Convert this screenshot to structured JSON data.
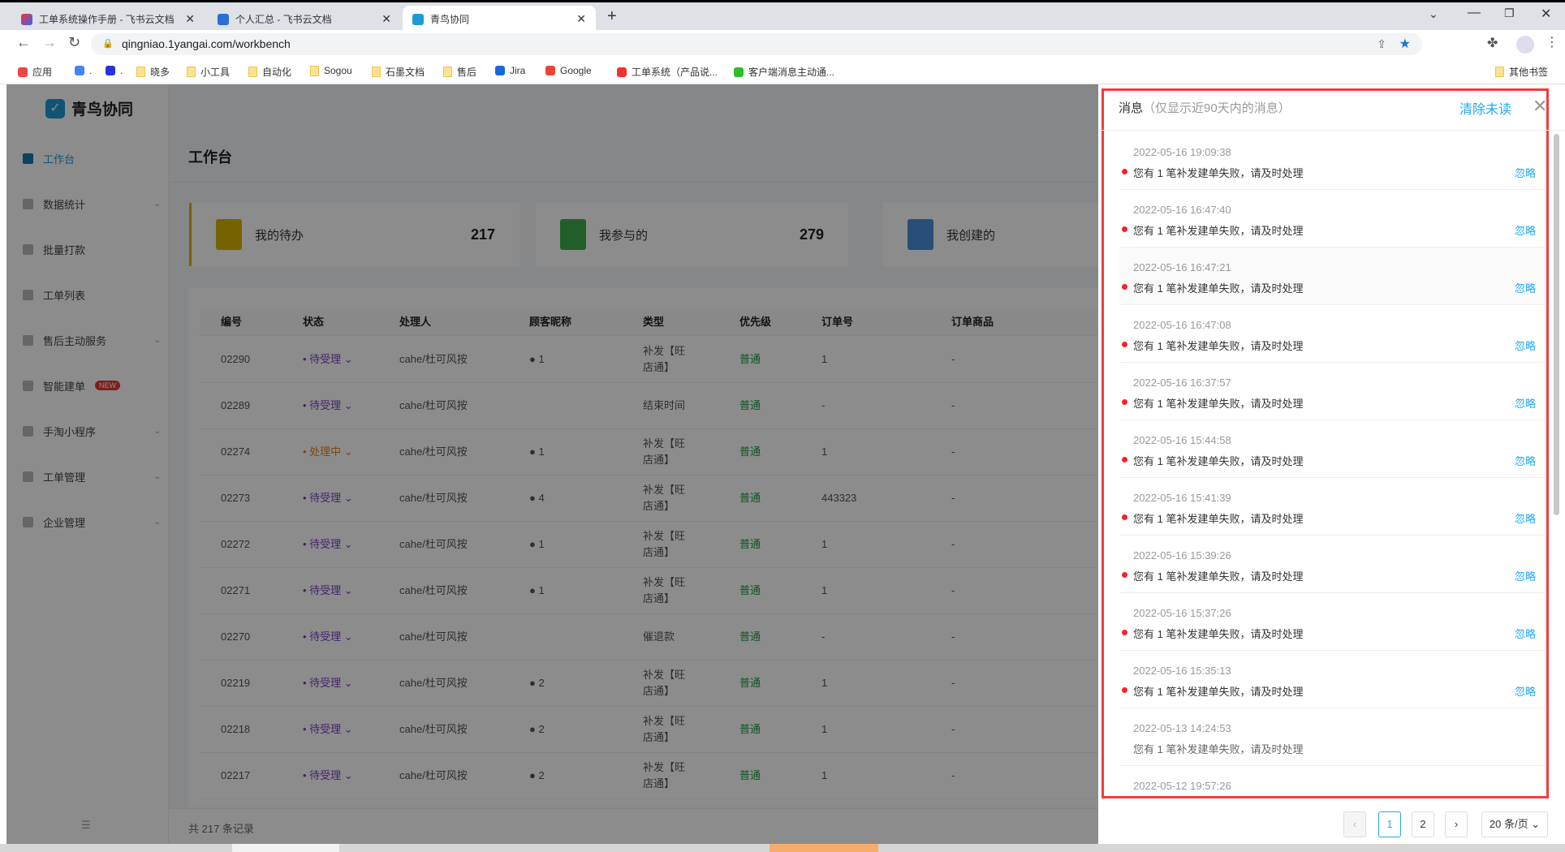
{
  "browser": {
    "tabs": [
      {
        "title": "工单系统操作手册 - 飞书云文档"
      },
      {
        "title": "个人汇总 - 飞书云文档"
      },
      {
        "title": "青鸟协同",
        "active": true
      }
    ],
    "url": "qingniao.1yangai.com/workbench",
    "bookmarks": [
      "应用",
      ".",
      ".",
      "晓多",
      "小工具",
      "自动化",
      "Sogou",
      "石墨文档",
      "售后",
      "Jira",
      "Google",
      "工单系统（产品说...",
      "客户端消息主动通..."
    ],
    "other_bookmarks": "其他书签"
  },
  "app": {
    "name": "青鸟协同",
    "brand_color": "#1e9ad6"
  },
  "sidebar": {
    "items": [
      {
        "label": "工作台",
        "active": true
      },
      {
        "label": "数据统计",
        "expand": true
      },
      {
        "label": "批量打款"
      },
      {
        "label": "工单列表"
      },
      {
        "label": "售后主动服务",
        "expand": true
      },
      {
        "label": "智能建单",
        "badge": "NEW"
      },
      {
        "label": "手淘小程序",
        "expand": true
      },
      {
        "label": "工单管理",
        "expand": true
      },
      {
        "label": "企业管理",
        "expand": true
      }
    ]
  },
  "main": {
    "title": "工作台",
    "cards": [
      {
        "label": "我的待办",
        "count": "217",
        "color": "#d8b400"
      },
      {
        "label": "我参与的",
        "count": "279",
        "color": "#3fae49"
      },
      {
        "label": "我创建的",
        "count": "",
        "color": "#4a90d9"
      }
    ],
    "table": {
      "columns": [
        "编号",
        "状态",
        "处理人",
        "顾客昵称",
        "类型",
        "优先级",
        "订单号",
        "订单商品"
      ],
      "rows": [
        [
          "02290",
          "待受理",
          "cahe/杜可风按",
          "1",
          "补发【旺店通】",
          "普通",
          "1",
          "-"
        ],
        [
          "02289",
          "待受理",
          "cahe/杜可风按",
          "",
          "结束时间",
          "普通",
          "-",
          "-"
        ],
        [
          "02274",
          "处理中",
          "cahe/杜可风按",
          "1",
          "补发【旺店通】",
          "普通",
          "1",
          "-"
        ],
        [
          "02273",
          "待受理",
          "cahe/杜可风按",
          "4",
          "补发【旺店通】",
          "普通",
          "443323",
          "-"
        ],
        [
          "02272",
          "待受理",
          "cahe/杜可风按",
          "1",
          "补发【旺店通】",
          "普通",
          "1",
          "-"
        ],
        [
          "02271",
          "待受理",
          "cahe/杜可风按",
          "1",
          "补发【旺店通】",
          "普通",
          "1",
          "-"
        ],
        [
          "02270",
          "待受理",
          "cahe/杜可风按",
          "",
          "催退款",
          "普通",
          "-",
          "-"
        ],
        [
          "02219",
          "待受理",
          "cahe/杜可风按",
          "2",
          "补发【旺店通】",
          "普通",
          "1",
          "-"
        ],
        [
          "02218",
          "待受理",
          "cahe/杜可风按",
          "2",
          "补发【旺店通】",
          "普通",
          "1",
          "-"
        ],
        [
          "02217",
          "待受理",
          "cahe/杜可风按",
          "2",
          "补发【旺店通】",
          "普通",
          "1",
          "-"
        ]
      ]
    },
    "total": "共 217 条记录"
  },
  "drawer": {
    "title": "消息",
    "subtitle": "（仅显示近90天内的消息）",
    "clear_label": "清除未读",
    "ignore_label": "忽略",
    "messages": [
      {
        "time": "2022-05-16 19:09:38",
        "text": "您有 1 笔补发建单失败，请及时处理",
        "unread": true
      },
      {
        "time": "2022-05-16 16:47:40",
        "text": "您有 1 笔补发建单失败，请及时处理",
        "unread": true
      },
      {
        "time": "2022-05-16 16:47:21",
        "text": "您有 1 笔补发建单失败，请及时处理",
        "unread": true
      },
      {
        "time": "2022-05-16 16:47:08",
        "text": "您有 1 笔补发建单失败，请及时处理",
        "unread": true
      },
      {
        "time": "2022-05-16 16:37:57",
        "text": "您有 1 笔补发建单失败，请及时处理",
        "unread": true
      },
      {
        "time": "2022-05-16 15:44:58",
        "text": "您有 1 笔补发建单失败，请及时处理",
        "unread": true
      },
      {
        "time": "2022-05-16 15:41:39",
        "text": "您有 1 笔补发建单失败，请及时处理",
        "unread": true
      },
      {
        "time": "2022-05-16 15:39:26",
        "text": "您有 1 笔补发建单失败，请及时处理",
        "unread": true
      },
      {
        "time": "2022-05-16 15:37:26",
        "text": "您有 1 笔补发建单失败，请及时处理",
        "unread": true
      },
      {
        "time": "2022-05-16 15:35:13",
        "text": "您有 1 笔补发建单失败，请及时处理",
        "unread": true
      },
      {
        "time": "2022-05-13 14:24:53",
        "text": "您有 1 笔补发建单失败，请及时处理",
        "unread": false
      },
      {
        "time": "2022-05-12 19:57:26",
        "text": "",
        "unread": false
      }
    ],
    "pagination": {
      "pages": [
        "1",
        "2"
      ],
      "current": "1",
      "page_size": "20 条/页"
    }
  }
}
